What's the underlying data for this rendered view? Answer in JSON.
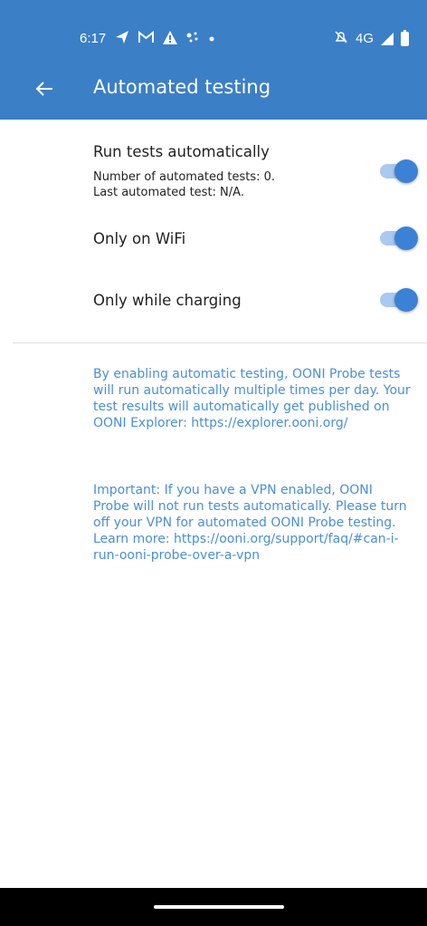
{
  "status_bar": {
    "time": "6:17",
    "network": "4G",
    "left_icons": [
      "navigation-icon",
      "gmail-icon",
      "alert-icon",
      "wifi-dots-icon",
      "dot-icon"
    ],
    "right_icons": [
      "mute-icon",
      "signal-icon",
      "battery-icon"
    ]
  },
  "app_bar": {
    "title": "Automated testing",
    "background": "#3b7fc7"
  },
  "settings": [
    {
      "title": "Run tests automatically",
      "subtitle_1": "Number of automated tests: 0.",
      "subtitle_2": "Last automated test: N/A.",
      "enabled": true
    },
    {
      "title": "Only on WiFi",
      "enabled": true
    },
    {
      "title": "Only while charging",
      "enabled": true
    }
  ],
  "info": {
    "paragraph_1": "By enabling automatic testing, OONI Probe tests will run automatically multiple times per day. Your test results will automatically get published on OONI Explorer: https://explorer.ooni.org/",
    "paragraph_2": "Important: If you have a VPN enabled, OONI Probe will not run tests automatically. Please turn off your VPN for automated OONI Probe testing. Learn more: https://ooni.org/support/faq/#can-i-run-ooni-probe-over-a-vpn",
    "color": "#4a8fd6"
  },
  "accent": "#3b82d6"
}
